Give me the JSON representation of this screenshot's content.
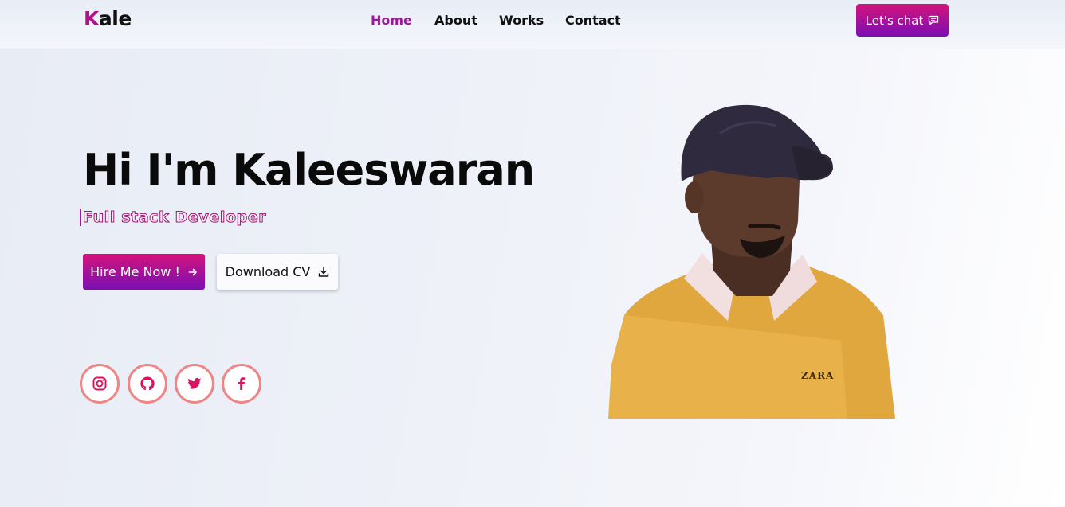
{
  "brand": {
    "first_letter": "K",
    "rest": "ale"
  },
  "nav": {
    "links": [
      {
        "label": "Home"
      },
      {
        "label": "About"
      },
      {
        "label": "Works"
      },
      {
        "label": "Contact"
      }
    ],
    "cta_label": "Let's chat"
  },
  "hero": {
    "title": "Hi I'm Kaleeswaran",
    "subtitle": "Full stack Developer",
    "hire_label": "Hire Me Now !",
    "cv_label": "Download CV",
    "photo_text": "ZARA"
  },
  "social": [
    "instagram-icon",
    "github-icon",
    "twitter-icon",
    "facebook-icon"
  ],
  "colors": {
    "brand": "#b0128a",
    "gradient_start": "#d4137c",
    "gradient_end": "#7a0fb3",
    "social_border": "#f08585",
    "social_icon": "#d8135f"
  }
}
